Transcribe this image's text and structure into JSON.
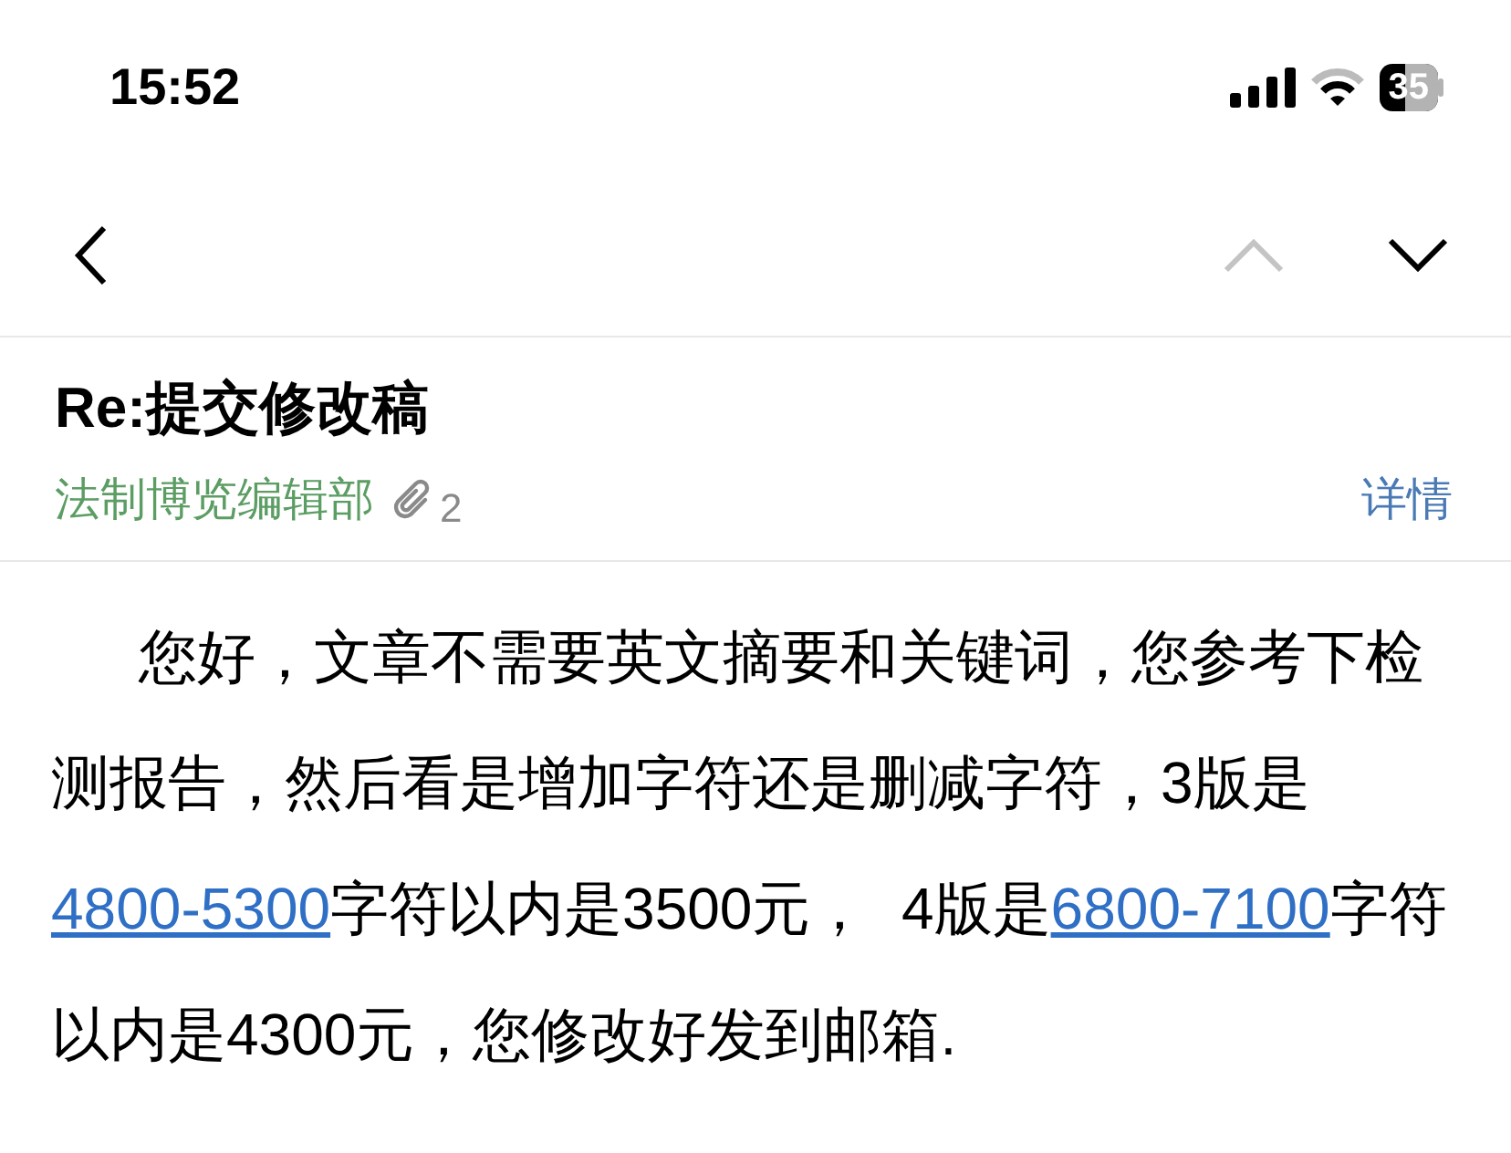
{
  "status_bar": {
    "time": "15:52",
    "battery": "35"
  },
  "nav": {
    "prev_disabled": true,
    "next_disabled": false
  },
  "email": {
    "subject": "Re:提交修改稿",
    "sender": "法制博览编辑部",
    "attachments": "2",
    "details": "详情",
    "body": [
      {
        "kind": "text",
        "text": "您好，文章不需要英文摘要和关键词，您参考下检测报告，然后看是增加字符还是删减字符，3版是"
      },
      {
        "kind": "link",
        "text": "4800-5300"
      },
      {
        "kind": "text",
        "text": "字符以内是3500元，  4版是"
      },
      {
        "kind": "link",
        "text": "6800-7100"
      },
      {
        "kind": "text",
        "text": "字符以内是4300元，您修改好发到邮箱."
      }
    ]
  }
}
